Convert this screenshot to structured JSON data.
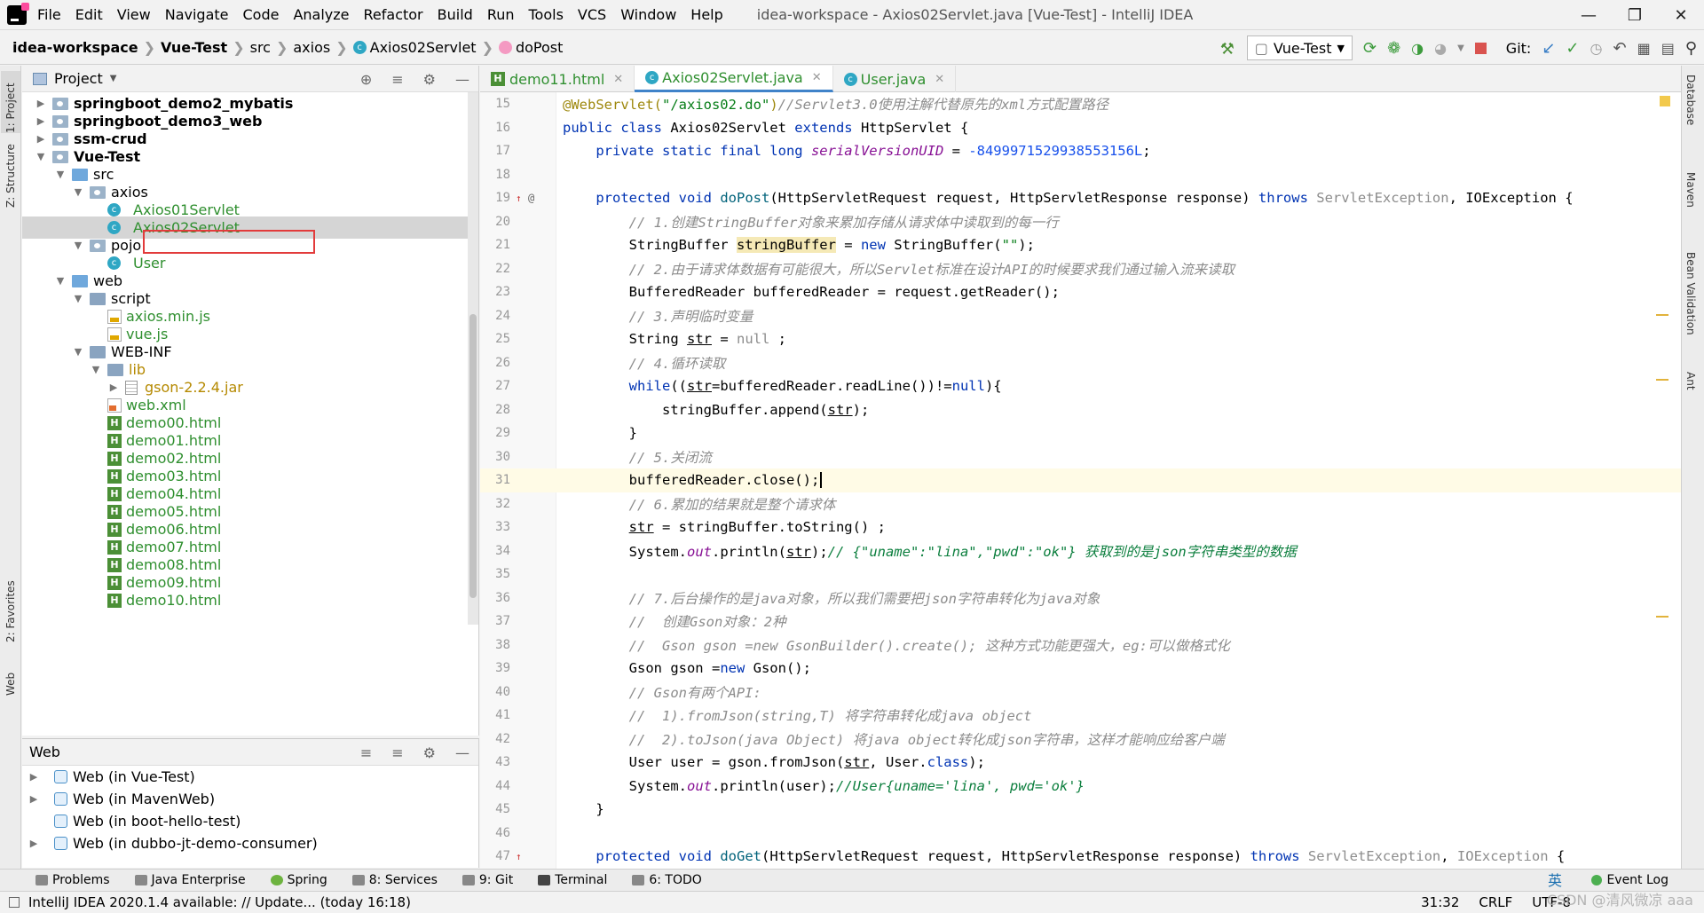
{
  "app": {
    "menu": [
      "File",
      "Edit",
      "View",
      "Navigate",
      "Code",
      "Analyze",
      "Refactor",
      "Build",
      "Run",
      "Tools",
      "VCS",
      "Window",
      "Help"
    ],
    "window_title": "idea-workspace - Axios02Servlet.java [Vue-Test] - IntelliJ IDEA"
  },
  "breadcrumb": {
    "items": [
      "idea-workspace",
      "Vue-Test",
      "src",
      "axios",
      "Axios02Servlet",
      "doPost"
    ]
  },
  "toolbar": {
    "run_config": "Vue-Test",
    "git_label": "Git:"
  },
  "project": {
    "title": "Project",
    "tree": [
      {
        "label": "springboot_demo2_mybatis",
        "bold": true
      },
      {
        "label": "springboot_demo3_web",
        "bold": true
      },
      {
        "label": "ssm-crud",
        "bold": true
      },
      {
        "label": "Vue-Test",
        "bold": true
      },
      {
        "label": "src"
      },
      {
        "label": "axios"
      },
      {
        "label": "Axios01Servlet"
      },
      {
        "label": "Axios02Servlet"
      },
      {
        "label": "pojo"
      },
      {
        "label": "User"
      },
      {
        "label": "web"
      },
      {
        "label": "script"
      },
      {
        "label": "axios.min.js"
      },
      {
        "label": "vue.js"
      },
      {
        "label": "WEB-INF"
      },
      {
        "label": "lib"
      },
      {
        "label": "gson-2.2.4.jar"
      },
      {
        "label": "web.xml"
      },
      {
        "label": "demo00.html"
      },
      {
        "label": "demo01.html"
      },
      {
        "label": "demo02.html"
      },
      {
        "label": "demo03.html"
      },
      {
        "label": "demo04.html"
      },
      {
        "label": "demo05.html"
      },
      {
        "label": "demo06.html"
      },
      {
        "label": "demo07.html"
      },
      {
        "label": "demo08.html"
      },
      {
        "label": "demo09.html"
      },
      {
        "label": "demo10.html"
      }
    ]
  },
  "web_panel": {
    "title": "Web",
    "items": [
      "Web (in Vue-Test)",
      "Web (in MavenWeb)",
      "Web (in boot-hello-test)",
      "Web (in dubbo-jt-demo-consumer)"
    ]
  },
  "editor": {
    "tabs": [
      "demo11.html",
      "Axios02Servlet.java",
      "User.java"
    ],
    "line_numbers": [
      "15",
      "16",
      "17",
      "18",
      "19",
      "20",
      "21",
      "22",
      "23",
      "24",
      "25",
      "26",
      "27",
      "28",
      "29",
      "30",
      "31",
      "32",
      "33",
      "34",
      "35",
      "36",
      "37",
      "38",
      "39",
      "40",
      "41",
      "42",
      "43",
      "44",
      "45",
      "46",
      "47"
    ]
  },
  "left_strip": {
    "project": "1: Project",
    "structure": "Z: Structure",
    "favorites": "2: Favorites",
    "web": "Web"
  },
  "right_strip": {
    "database": "Database",
    "maven": "Maven",
    "bean": "Bean Validation",
    "ant": "Ant"
  },
  "bottom_tools": [
    "Problems",
    "Java Enterprise",
    "Spring",
    "8: Services",
    "9: Git",
    "Terminal",
    "6: TODO"
  ],
  "event_log": "Event Log",
  "status": {
    "message": "IntelliJ IDEA 2020.1.4 available: // Update... (today 16:18)",
    "position": "31:32",
    "line_sep": "CRLF",
    "encoding": "UTF-8",
    "ime": "英",
    "watermark": "CSDN @清风微凉 aaa"
  }
}
